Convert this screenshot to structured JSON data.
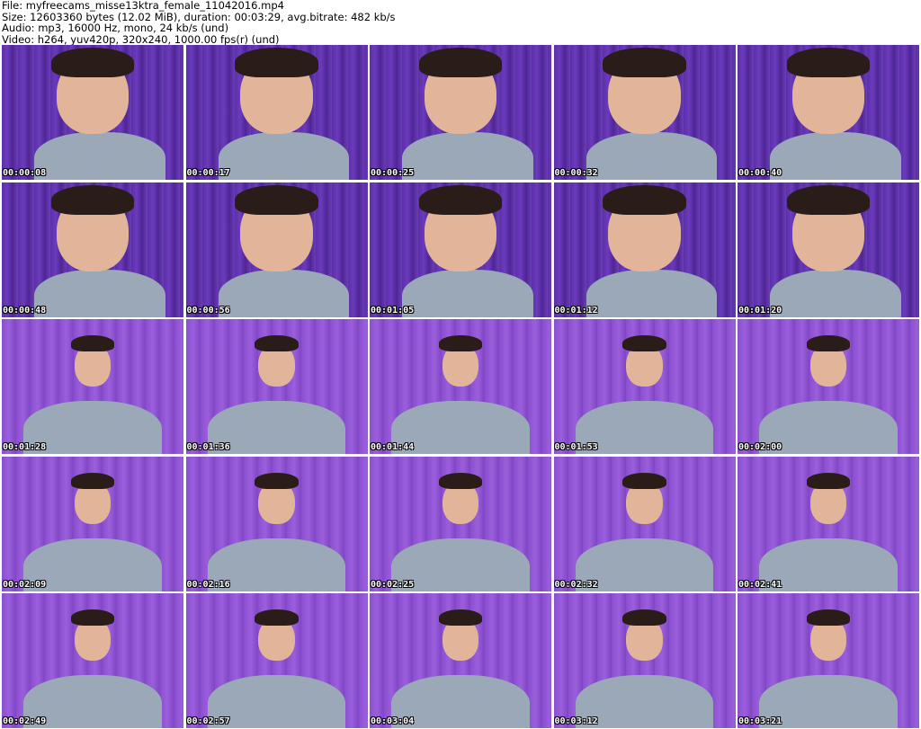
{
  "header": {
    "file_line": "File: myfreecams_misse13ktra_female_11042016.mp4",
    "size_line": "Size: 12603360 bytes (12.02 MiB), duration: 00:03:29, avg.bitrate: 482 kb/s",
    "audio_line": "Audio: mp3, 16000 Hz, mono, 24 kb/s (und)",
    "video_line": "Video: h264, yuv420p, 320x240, 1000.00 fps(r) (und)"
  },
  "thumbnails": [
    {
      "timestamp": "00:00:08"
    },
    {
      "timestamp": "00:00:17"
    },
    {
      "timestamp": "00:00:25"
    },
    {
      "timestamp": "00:00:32"
    },
    {
      "timestamp": "00:00:40"
    },
    {
      "timestamp": "00:00:48"
    },
    {
      "timestamp": "00:00:56"
    },
    {
      "timestamp": "00:01:05"
    },
    {
      "timestamp": "00:01:12"
    },
    {
      "timestamp": "00:01:20"
    },
    {
      "timestamp": "00:01:28"
    },
    {
      "timestamp": "00:01:36"
    },
    {
      "timestamp": "00:01:44"
    },
    {
      "timestamp": "00:01:53"
    },
    {
      "timestamp": "00:02:00"
    },
    {
      "timestamp": "00:02:09"
    },
    {
      "timestamp": "00:02:16"
    },
    {
      "timestamp": "00:02:25"
    },
    {
      "timestamp": "00:02:32"
    },
    {
      "timestamp": "00:02:41"
    },
    {
      "timestamp": "00:02:49"
    },
    {
      "timestamp": "00:02:57"
    },
    {
      "timestamp": "00:03:04"
    },
    {
      "timestamp": "00:03:12"
    },
    {
      "timestamp": "00:03:21"
    }
  ]
}
